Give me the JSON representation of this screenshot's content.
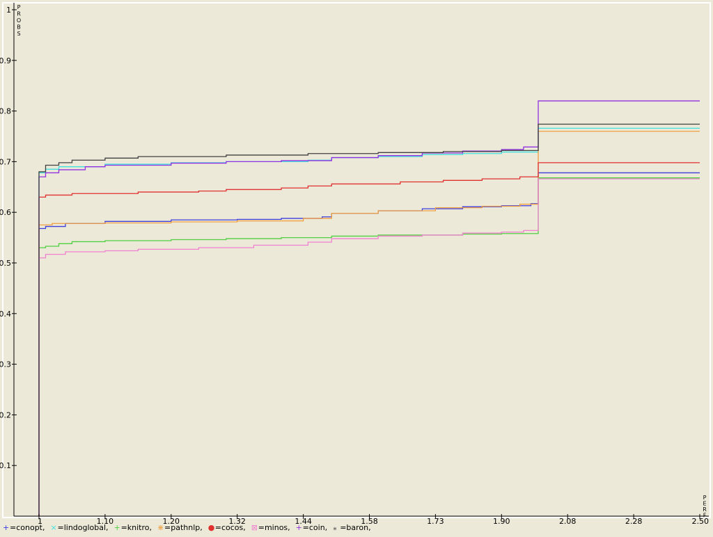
{
  "colors": {
    "background": "#ece9d8",
    "axis": "#000000",
    "frame": "#ffffff"
  },
  "chart_data": {
    "type": "line",
    "step": true,
    "title": "",
    "xlabel": "PERF",
    "ylabel": "PROBS",
    "xlim": [
      1,
      2.5
    ],
    "ylim": [
      0,
      1
    ],
    "x_ticks": [
      1,
      1.1,
      1.2,
      1.32,
      1.44,
      1.58,
      1.73,
      1.9,
      2.08,
      2.28,
      2.5
    ],
    "x_tick_labels": [
      "1",
      "1.10",
      "1.20",
      "1.32",
      "1.44",
      "1.58",
      "1.73",
      "1.90",
      "2.08",
      "2.28",
      "2.50"
    ],
    "y_ticks": [
      0.1,
      0.2,
      0.3,
      0.4,
      0.5,
      0.6,
      0.7,
      0.8,
      0.9,
      1
    ],
    "y_tick_labels": [
      "0.1",
      "0.2",
      "0.3",
      "0.4",
      "0.5",
      "0.6",
      "0.7",
      "0.8",
      "0.9",
      "1"
    ],
    "grid": false,
    "legend_position": "bottom",
    "series": [
      {
        "name": "conopt",
        "marker": "+",
        "color": "#3c3cdc",
        "points": [
          [
            1,
            0
          ],
          [
            1,
            0.568
          ],
          [
            1.01,
            0.572
          ],
          [
            1.04,
            0.578
          ],
          [
            1.1,
            0.582
          ],
          [
            1.2,
            0.585
          ],
          [
            1.32,
            0.586
          ],
          [
            1.4,
            0.588
          ],
          [
            1.48,
            0.591
          ],
          [
            1.5,
            0.598
          ],
          [
            1.6,
            0.603
          ],
          [
            1.7,
            0.607
          ],
          [
            1.8,
            0.611
          ],
          [
            1.9,
            0.613
          ],
          [
            1.98,
            0.617
          ],
          [
            2.0,
            0.62
          ],
          [
            2.0,
            0.678
          ],
          [
            2.5,
            0.678
          ]
        ]
      },
      {
        "name": "lindoglobal",
        "marker": "×",
        "color": "#40e0e0",
        "points": [
          [
            1,
            0
          ],
          [
            1,
            0.678
          ],
          [
            1.01,
            0.685
          ],
          [
            1.03,
            0.69
          ],
          [
            1.1,
            0.695
          ],
          [
            1.2,
            0.698
          ],
          [
            1.3,
            0.7
          ],
          [
            1.45,
            0.703
          ],
          [
            1.5,
            0.708
          ],
          [
            1.6,
            0.71
          ],
          [
            1.7,
            0.714
          ],
          [
            1.8,
            0.716
          ],
          [
            1.9,
            0.719
          ],
          [
            2.0,
            0.722
          ],
          [
            2.0,
            0.766
          ],
          [
            2.5,
            0.766
          ]
        ]
      },
      {
        "name": "knitro",
        "marker": "+",
        "color": "#50d040",
        "points": [
          [
            1,
            0
          ],
          [
            1,
            0.53
          ],
          [
            1.01,
            0.533
          ],
          [
            1.03,
            0.538
          ],
          [
            1.05,
            0.542
          ],
          [
            1.1,
            0.544
          ],
          [
            1.2,
            0.546
          ],
          [
            1.3,
            0.548
          ],
          [
            1.4,
            0.55
          ],
          [
            1.5,
            0.553
          ],
          [
            1.6,
            0.555
          ],
          [
            1.8,
            0.557
          ],
          [
            1.9,
            0.558
          ],
          [
            2.0,
            0.562
          ],
          [
            2.0,
            0.668
          ],
          [
            2.5,
            0.668
          ]
        ]
      },
      {
        "name": "pathnlp",
        "marker": "⋇",
        "color": "#f0a040",
        "points": [
          [
            1,
            0
          ],
          [
            1,
            0.575
          ],
          [
            1.02,
            0.578
          ],
          [
            1.1,
            0.579
          ],
          [
            1.2,
            0.581
          ],
          [
            1.32,
            0.583
          ],
          [
            1.44,
            0.588
          ],
          [
            1.5,
            0.598
          ],
          [
            1.6,
            0.603
          ],
          [
            1.73,
            0.609
          ],
          [
            1.85,
            0.612
          ],
          [
            1.95,
            0.616
          ],
          [
            2.0,
            0.624
          ],
          [
            2.0,
            0.76
          ],
          [
            2.5,
            0.76
          ]
        ]
      },
      {
        "name": "cocos",
        "marker": "●",
        "color": "#e03030",
        "points": [
          [
            1,
            0
          ],
          [
            1,
            0.63
          ],
          [
            1.01,
            0.634
          ],
          [
            1.05,
            0.637
          ],
          [
            1.15,
            0.64
          ],
          [
            1.25,
            0.642
          ],
          [
            1.3,
            0.645
          ],
          [
            1.4,
            0.648
          ],
          [
            1.45,
            0.652
          ],
          [
            1.5,
            0.656
          ],
          [
            1.65,
            0.66
          ],
          [
            1.75,
            0.663
          ],
          [
            1.85,
            0.666
          ],
          [
            1.95,
            0.67
          ],
          [
            2.0,
            0.678
          ],
          [
            2.0,
            0.698
          ],
          [
            2.5,
            0.698
          ]
        ]
      },
      {
        "name": "minos",
        "marker": "⊠",
        "color": "#f080d0",
        "points": [
          [
            1,
            0
          ],
          [
            1,
            0.51
          ],
          [
            1.01,
            0.517
          ],
          [
            1.04,
            0.522
          ],
          [
            1.1,
            0.524
          ],
          [
            1.15,
            0.527
          ],
          [
            1.25,
            0.53
          ],
          [
            1.35,
            0.535
          ],
          [
            1.45,
            0.541
          ],
          [
            1.5,
            0.548
          ],
          [
            1.6,
            0.553
          ],
          [
            1.7,
            0.555
          ],
          [
            1.8,
            0.559
          ],
          [
            1.9,
            0.561
          ],
          [
            1.96,
            0.564
          ],
          [
            2.0,
            0.57
          ],
          [
            2.0,
            0.666
          ],
          [
            2.5,
            0.666
          ]
        ]
      },
      {
        "name": "coin",
        "marker": "+",
        "color": "#9030e0",
        "points": [
          [
            1,
            0
          ],
          [
            1,
            0.67
          ],
          [
            1.01,
            0.678
          ],
          [
            1.03,
            0.684
          ],
          [
            1.07,
            0.69
          ],
          [
            1.1,
            0.693
          ],
          [
            1.2,
            0.697
          ],
          [
            1.3,
            0.7
          ],
          [
            1.4,
            0.702
          ],
          [
            1.5,
            0.708
          ],
          [
            1.6,
            0.712
          ],
          [
            1.7,
            0.717
          ],
          [
            1.8,
            0.721
          ],
          [
            1.9,
            0.724
          ],
          [
            1.96,
            0.729
          ],
          [
            2.0,
            0.732
          ],
          [
            2.0,
            0.82
          ],
          [
            2.5,
            0.82
          ]
        ]
      },
      {
        "name": "baron",
        "marker": "⁎",
        "color": "#404040",
        "points": [
          [
            1,
            0
          ],
          [
            1,
            0.68
          ],
          [
            1.01,
            0.693
          ],
          [
            1.03,
            0.698
          ],
          [
            1.05,
            0.703
          ],
          [
            1.1,
            0.707
          ],
          [
            1.15,
            0.71
          ],
          [
            1.3,
            0.713
          ],
          [
            1.45,
            0.716
          ],
          [
            1.6,
            0.718
          ],
          [
            1.75,
            0.72
          ],
          [
            1.9,
            0.722
          ],
          [
            2.0,
            0.726
          ],
          [
            2.0,
            0.774
          ],
          [
            2.5,
            0.774
          ]
        ]
      }
    ]
  }
}
